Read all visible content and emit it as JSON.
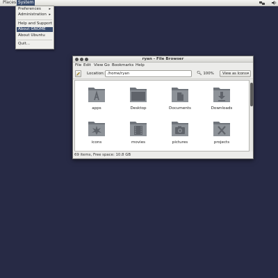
{
  "panel": {
    "places": "Places",
    "system": "System"
  },
  "system_menu": {
    "preferences": "Preferences",
    "administration": "Administration",
    "help": "Help and Support",
    "about_gnome": "About GNOME",
    "about_ubuntu": "About Ubuntu",
    "quit": "Quit...",
    "submenu_arrow": "▸"
  },
  "window": {
    "title": "ryan - File Browser",
    "menus": [
      "File",
      "Edit",
      "View",
      "Go",
      "Bookmarks",
      "Help"
    ],
    "location_label": "Location:",
    "location_value": "/home/ryan",
    "zoom": "100%",
    "view_mode": "View as Icons",
    "status": "69 items, Free space: 10.8 GB"
  },
  "files": [
    {
      "name": "apps",
      "icon": "apps-folder-icon"
    },
    {
      "name": "Desktop",
      "icon": "desktop-folder-icon"
    },
    {
      "name": "Documents",
      "icon": "documents-folder-icon"
    },
    {
      "name": "Downloads",
      "icon": "downloads-folder-icon"
    },
    {
      "name": "icons",
      "icon": "icons-folder-icon"
    },
    {
      "name": "movies",
      "icon": "movies-folder-icon"
    },
    {
      "name": "pictures",
      "icon": "pictures-folder-icon"
    },
    {
      "name": "projects",
      "icon": "projects-folder-icon"
    }
  ],
  "colors": {
    "desktop_bg": "#272a45",
    "highlight": "#3a4d6f",
    "folder": "#8a8f96"
  }
}
